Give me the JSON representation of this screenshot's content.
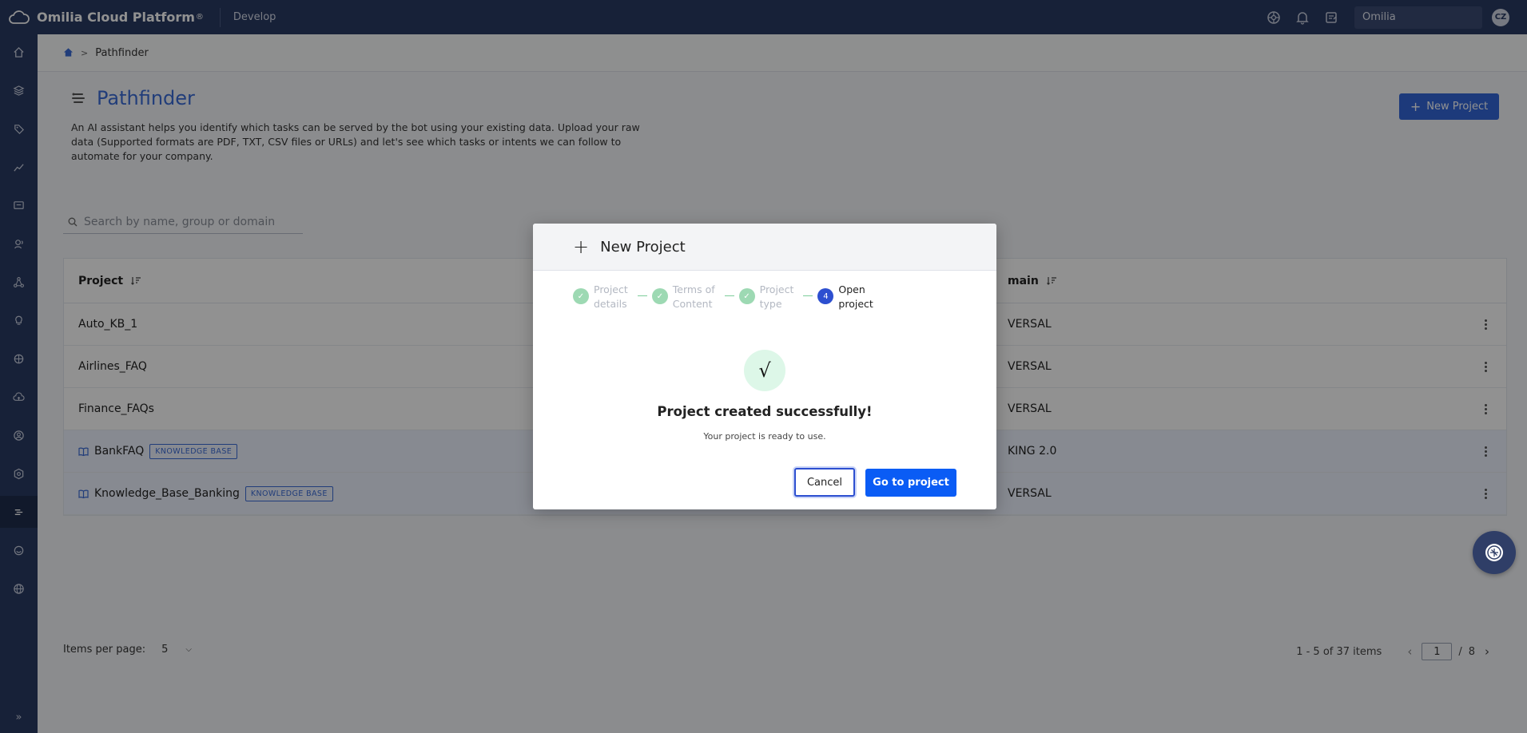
{
  "topbar": {
    "brand_name": "Omilia Cloud Platform",
    "brand_mark": "®",
    "section": "Develop",
    "icons": [
      "help-icon",
      "bell-icon",
      "notes-icon"
    ],
    "org_name": "Omilia",
    "avatar_initials": "CZ"
  },
  "sidebar": {
    "items": [
      "home-icon",
      "layers-icon",
      "tag-icon",
      "analytics-icon",
      "monitor-icon",
      "voice-icon",
      "network-icon",
      "bulb-icon",
      "brain-icon",
      "cloud-icon",
      "person-icon",
      "settings-icon",
      "pathfinder-icon",
      "agent-icon",
      "globe-icon"
    ],
    "active_index": 12,
    "collapse_label": "»"
  },
  "breadcrumb": {
    "separator": ">",
    "current": "Pathfinder"
  },
  "page": {
    "title": "Pathfinder",
    "description": "An AI assistant helps you identify which tasks can be served by the bot using your existing data. Upload your raw data (Supported formats are PDF, TXT, CSV files or URLs) and let's see which tasks or intents we can follow to automate for your company.",
    "new_project_label": "New Project",
    "search_placeholder": "Search by name, group or domain"
  },
  "table": {
    "columns": {
      "project": "Project",
      "domain": "main"
    },
    "rows": [
      {
        "name": "Auto_KB_1",
        "badge": "",
        "domain": "VERSAL",
        "kb": false
      },
      {
        "name": "Airlines_FAQ",
        "badge": "",
        "domain": "VERSAL",
        "kb": false
      },
      {
        "name": "Finance_FAQs",
        "badge": "",
        "domain": "VERSAL",
        "kb": false
      },
      {
        "name": "BankFAQ",
        "badge": "KNOWLEDGE BASE",
        "domain": "KING 2.0",
        "kb": true
      },
      {
        "name": "Knowledge_Base_Banking",
        "badge": "KNOWLEDGE BASE",
        "domain": "VERSAL",
        "kb": true
      }
    ]
  },
  "pagination": {
    "items_per_page_label": "Items per page:",
    "items_per_page_value": "5",
    "range": "1 - 5 of 37 items",
    "current_page": "1",
    "separator": "/",
    "total_pages": "8"
  },
  "modal": {
    "title": "New Project",
    "steps": [
      {
        "label_line1": "Project",
        "label_line2": "details",
        "state": "done",
        "marker": "✓"
      },
      {
        "label_line1": "Terms of",
        "label_line2": "Content",
        "state": "done",
        "marker": "✓"
      },
      {
        "label_line1": "Project",
        "label_line2": "type",
        "state": "done",
        "marker": "✓"
      },
      {
        "label_line1": "Open",
        "label_line2": "project",
        "state": "current",
        "marker": "4"
      }
    ],
    "success_mark": "√",
    "success_title": "Project created successfully!",
    "success_subtitle": "Your project is ready to use.",
    "cancel_label": "Cancel",
    "go_label": "Go to project"
  },
  "colors": {
    "topbar": "#2a3a63",
    "accent": "#3b6bd6",
    "primary_button": "#0a5cf5",
    "step_done": "#9dd9b3",
    "step_current": "#2d4fd0"
  }
}
